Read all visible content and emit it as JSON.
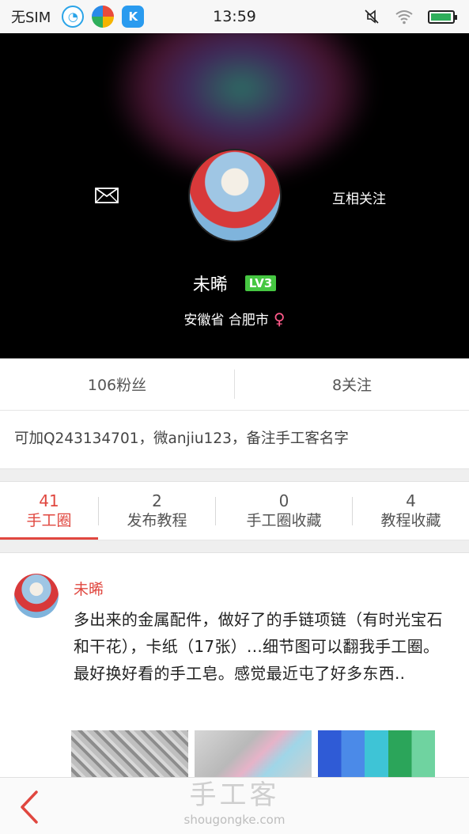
{
  "status_bar": {
    "carrier": "无SIM",
    "time": "13:59",
    "app_icons": [
      "qq-icon",
      "browser-icon",
      "k-app-icon"
    ],
    "battery_level": 0.95,
    "k_letter": "K"
  },
  "profile": {
    "follow_each_other": "互相关注",
    "username": "未晞",
    "level": "LV3",
    "location": "安徽省 合肥市",
    "gender_symbol": "♀"
  },
  "stats": {
    "fans": "106粉丝",
    "following": "8关注"
  },
  "bio": "可加Q243134701，微anjiu123，备注手工客名字",
  "tabs": [
    {
      "count": "41",
      "label": "手工圈",
      "active": true
    },
    {
      "count": "2",
      "label": "发布教程",
      "active": false
    },
    {
      "count": "0",
      "label": "手工圈收藏",
      "active": false
    },
    {
      "count": "4",
      "label": "教程收藏",
      "active": false
    }
  ],
  "post": {
    "author": "未晞",
    "text": "多出来的金属配件，做好了的手链项链（有时光宝石和干花），卡纸（17张）...细节图可以翻我手工圈。最好换好看的手工皂。感觉最近屯了好多东西.."
  },
  "footer": {
    "watermark_logo": "手工客",
    "watermark_url": "shougongke.com"
  },
  "colors": {
    "accent": "#e0473f",
    "level_badge": "#46c742",
    "gender": "#ff5a8a"
  }
}
